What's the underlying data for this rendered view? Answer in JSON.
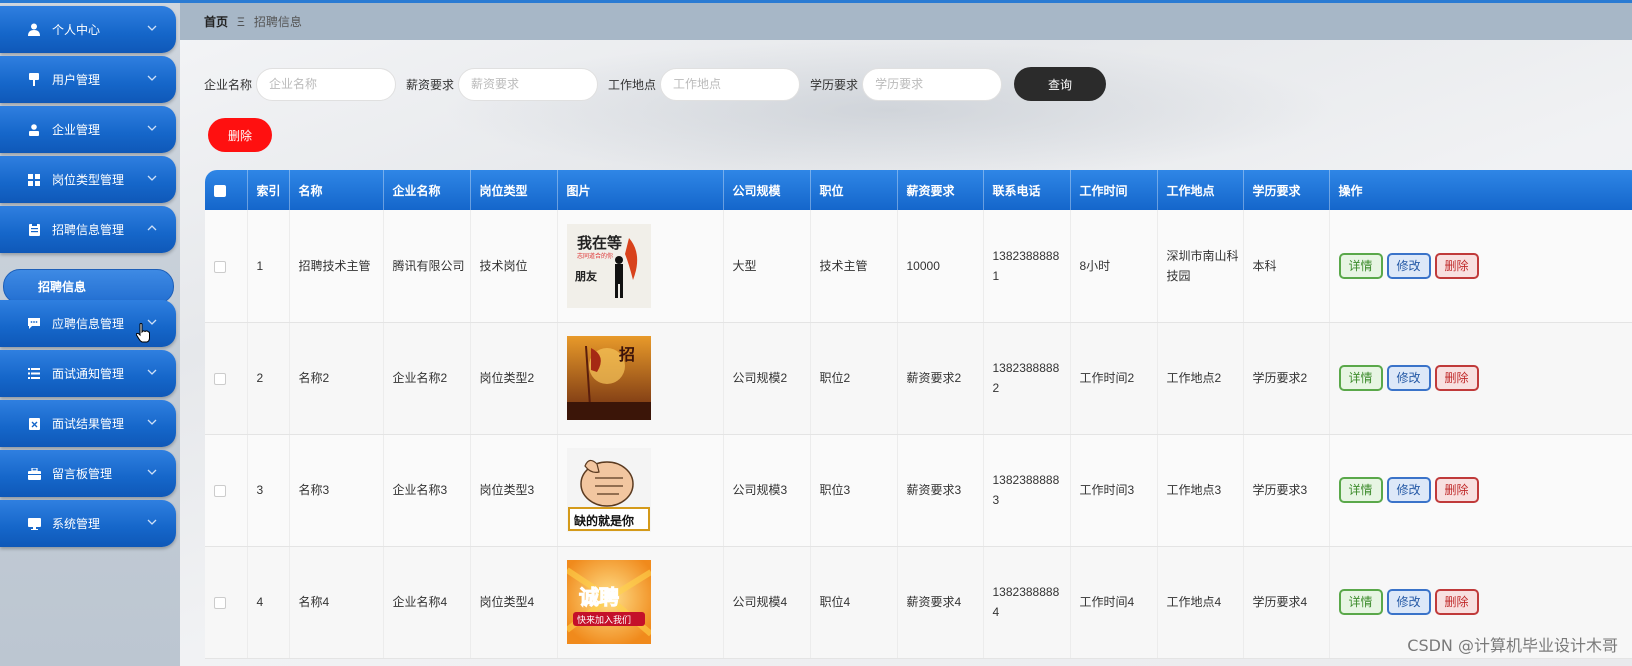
{
  "sidebar": {
    "items": [
      {
        "label": "个人中心",
        "icon": "user-icon"
      },
      {
        "label": "用户管理",
        "icon": "user-manage-icon"
      },
      {
        "label": "企业管理",
        "icon": "company-icon"
      },
      {
        "label": "岗位类型管理",
        "icon": "grid-icon"
      },
      {
        "label": "招聘信息管理",
        "icon": "clipboard-icon"
      },
      {
        "label": "应聘信息管理",
        "icon": "chat-icon"
      },
      {
        "label": "面试通知管理",
        "icon": "list-icon"
      },
      {
        "label": "面试结果管理",
        "icon": "result-icon"
      },
      {
        "label": "留言板管理",
        "icon": "briefcase-icon"
      },
      {
        "label": "系统管理",
        "icon": "monitor-icon"
      }
    ],
    "sub_item": "招聘信息"
  },
  "breadcrumb": {
    "home": "首页",
    "separator": "Ξ",
    "current": "招聘信息"
  },
  "search": {
    "company_label": "企业名称",
    "company_placeholder": "企业名称",
    "salary_label": "薪资要求",
    "salary_placeholder": "薪资要求",
    "location_label": "工作地点",
    "location_placeholder": "工作地点",
    "education_label": "学历要求",
    "education_placeholder": "学历要求",
    "query_button": "查询"
  },
  "batch_delete_button": "删除",
  "table": {
    "headers": [
      "",
      "索引",
      "名称",
      "企业名称",
      "岗位类型",
      "图片",
      "公司规模",
      "职位",
      "薪资要求",
      "联系电话",
      "工作时间",
      "工作地点",
      "学历要求",
      "操作"
    ],
    "rows": [
      {
        "index": "1",
        "name": "招聘技术主管",
        "company": "腾讯有限公司",
        "job_type": "技术岗位",
        "image_text": "我在等 志同道合的你 朋友",
        "scale": "大型",
        "position": "技术主管",
        "salary": "10000",
        "phone": "13823888881",
        "work_time": "8小时",
        "location": "深圳市南山科技园",
        "education": "本科"
      },
      {
        "index": "2",
        "name": "名称2",
        "company": "企业名称2",
        "job_type": "岗位类型2",
        "image_text": "招",
        "scale": "公司规模2",
        "position": "职位2",
        "salary": "薪资要求2",
        "phone": "13823888882",
        "work_time": "工作时间2",
        "location": "工作地点2",
        "education": "学历要求2"
      },
      {
        "index": "3",
        "name": "名称3",
        "company": "企业名称3",
        "job_type": "岗位类型3",
        "image_text": "缺的就是你",
        "scale": "公司规模3",
        "position": "职位3",
        "salary": "薪资要求3",
        "phone": "13823888883",
        "work_time": "工作时间3",
        "location": "工作地点3",
        "education": "学历要求3"
      },
      {
        "index": "4",
        "name": "名称4",
        "company": "企业名称4",
        "job_type": "岗位类型4",
        "image_text": "诚聘 快来加入我们",
        "scale": "公司规模4",
        "position": "职位4",
        "salary": "薪资要求4",
        "phone": "13823888884",
        "work_time": "工作时间4",
        "location": "工作地点4",
        "education": "学历要求4"
      }
    ],
    "actions": {
      "detail": "详情",
      "edit": "修改",
      "delete": "删除"
    }
  },
  "watermark": "CSDN @计算机毕业设计木哥",
  "colors": {
    "sidebar_blue": "#1566c9",
    "header_blue": "#1f76d8",
    "delete_red": "#ff1010",
    "query_dark": "#2b2b2b"
  }
}
